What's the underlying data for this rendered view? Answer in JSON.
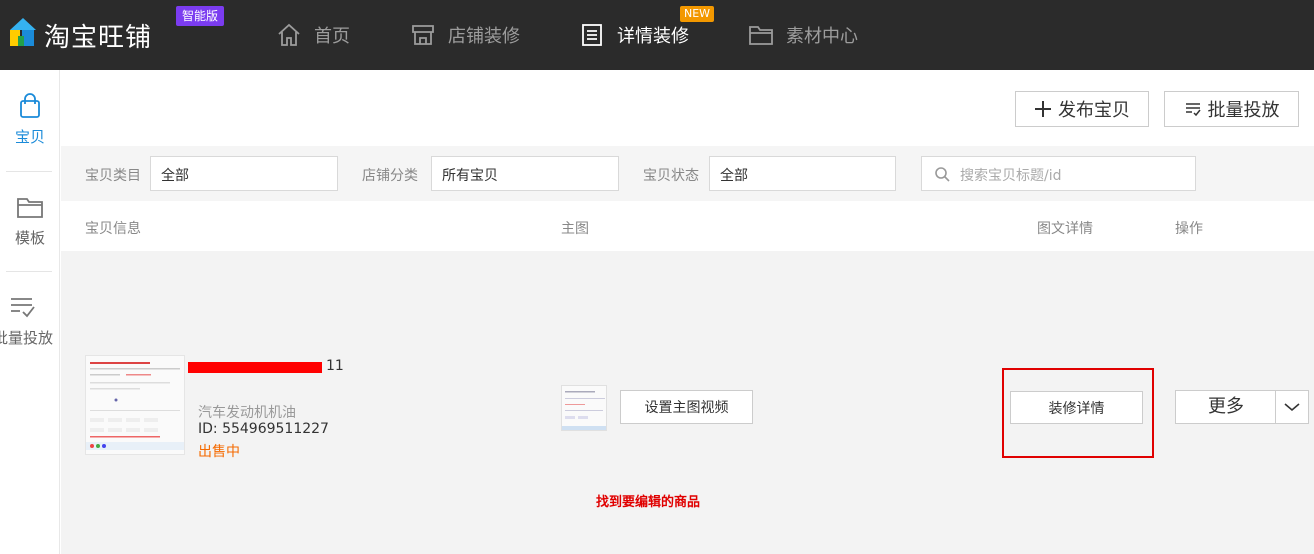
{
  "header": {
    "logo_text": "淘宝旺铺",
    "edition_badge": "智能版",
    "nav": [
      {
        "label": "首页",
        "icon": "home-icon"
      },
      {
        "label": "店铺装修",
        "icon": "shop-icon"
      },
      {
        "label": "详情装修",
        "icon": "detail-list-icon",
        "badge": "NEW",
        "active": true
      },
      {
        "label": "素材中心",
        "icon": "folder-icon"
      }
    ]
  },
  "sidebar": {
    "items": [
      {
        "label": "宝贝",
        "icon": "bag-icon",
        "active": true
      },
      {
        "label": "模板",
        "icon": "folder-icon"
      },
      {
        "label": "批量投放",
        "icon": "batch-list-icon"
      }
    ]
  },
  "actions": {
    "publish_label": "发布宝贝",
    "batch_label": "批量投放"
  },
  "filters": {
    "category_label": "宝贝类目",
    "category_value": "全部",
    "shop_category_label": "店铺分类",
    "shop_category_value": "所有宝贝",
    "status_label": "宝贝状态",
    "status_value": "全部",
    "search_placeholder": "搜索宝贝标题/id"
  },
  "table": {
    "columns": [
      "宝贝信息",
      "主图",
      "图文详情",
      "操作"
    ],
    "rows": [
      {
        "title_suffix": "11",
        "category": "汽车发动机机油",
        "id": "ID: 554969511227",
        "status": "出售中",
        "main_image_button": "设置主图视频",
        "detail_button": "装修详情",
        "more_label": "更多"
      }
    ]
  },
  "annotation": "找到要编辑的商品",
  "colors": {
    "topbar": "#2b2b2b",
    "accent": "#1b8bd9",
    "status": "#f56a00",
    "highlight": "#e00000",
    "edition_badge": "#7b3cf0",
    "new_badge": "#f39800"
  }
}
